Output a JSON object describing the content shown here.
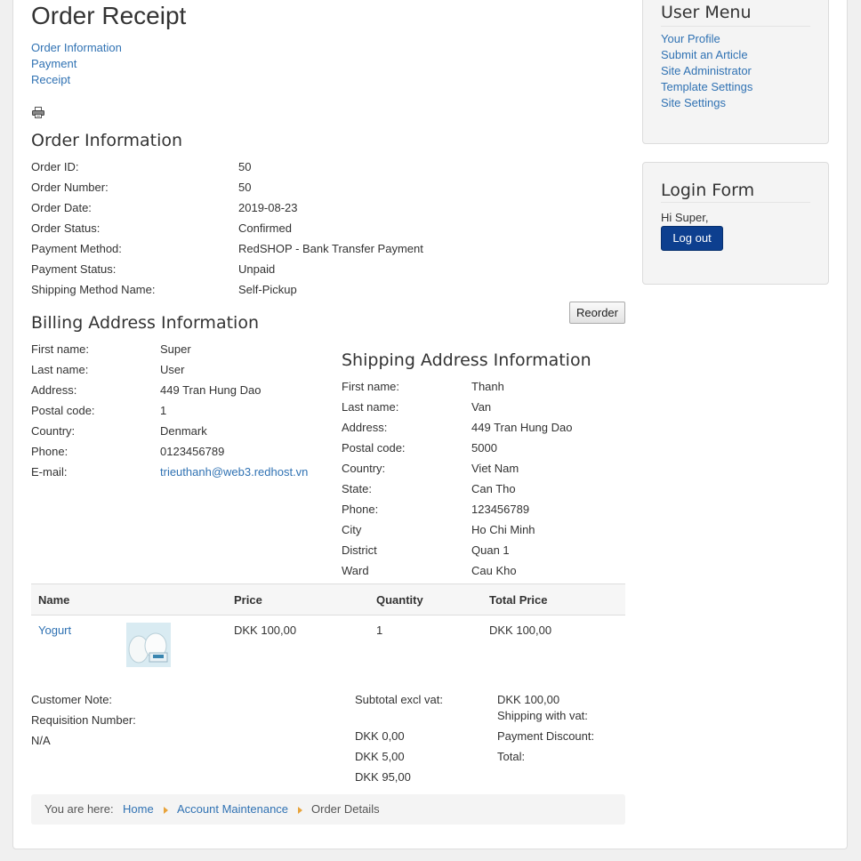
{
  "page": {
    "title": "Order Receipt"
  },
  "steps": [
    "Order Information",
    "Payment",
    "Receipt"
  ],
  "order_info": {
    "heading": "Order Information",
    "rows": [
      {
        "label": "Order ID:",
        "value": "50"
      },
      {
        "label": "Order Number:",
        "value": "50"
      },
      {
        "label": "Order Date:",
        "value": "2019-08-23"
      },
      {
        "label": "Order Status:",
        "value": "Confirmed"
      },
      {
        "label": "Payment Method:",
        "value": "RedSHOP - Bank Transfer Payment"
      },
      {
        "label": "Payment Status:",
        "value": "Unpaid"
      },
      {
        "label": "Shipping Method Name:",
        "value": "Self-Pickup"
      }
    ]
  },
  "reorder_label": "Reorder",
  "billing": {
    "heading": "Billing Address Information",
    "rows": [
      {
        "label": "First name:",
        "value": "Super"
      },
      {
        "label": "Last name:",
        "value": "User"
      },
      {
        "label": "Address:",
        "value": "449 Tran Hung Dao"
      },
      {
        "label": "Postal code:",
        "value": "1"
      },
      {
        "label": "Country:",
        "value": "Denmark"
      },
      {
        "label": "Phone:",
        "value": "0123456789"
      },
      {
        "label": "E-mail:",
        "value": "trieuthanh@web3.redhost.vn"
      }
    ]
  },
  "shipping": {
    "heading": "Shipping Address Information",
    "rows": [
      {
        "label": "First name:",
        "value": "Thanh"
      },
      {
        "label": "Last name:",
        "value": "Van"
      },
      {
        "label": "Address:",
        "value": "449 Tran Hung Dao"
      },
      {
        "label": "Postal code:",
        "value": "5000"
      },
      {
        "label": "Country:",
        "value": "Viet Nam"
      },
      {
        "label": "State:",
        "value": "Can Tho"
      },
      {
        "label": "Phone:",
        "value": "123456789"
      },
      {
        "label": "City",
        "value": "Ho Chi Minh"
      },
      {
        "label": "District",
        "value": "Quan 1"
      },
      {
        "label": "Ward",
        "value": "Cau Kho"
      }
    ]
  },
  "table": {
    "headers": {
      "name": "Name",
      "price": "Price",
      "quantity": "Quantity",
      "total": "Total Price"
    },
    "items": [
      {
        "name": "Yogurt",
        "price": "DKK 100,00",
        "quantity": "1",
        "total": "DKK 100,00"
      }
    ]
  },
  "notes": {
    "customer_note": "Customer Note:",
    "requisition": "Requisition Number:",
    "requisition_value": "N/A"
  },
  "totals": {
    "subtotal_label": "Subtotal excl vat:",
    "subtotal_value": "DKK 100,00",
    "shipping_label": "Shipping with vat:",
    "discount_label": "Payment Discount:",
    "total_label": "Total:",
    "value_1": "DKK 0,00",
    "value_2": "DKK 5,00",
    "value_3": "DKK 95,00"
  },
  "breadcrumb": {
    "prefix": "You are here:",
    "items": [
      "Home",
      "Account Maintenance",
      "Order Details"
    ]
  },
  "user_menu": {
    "title": "User Menu",
    "items": [
      "Your Profile",
      "Submit an Article",
      "Site Administrator",
      "Template Settings",
      "Site Settings"
    ]
  },
  "login": {
    "title": "Login Form",
    "greeting": "Hi Super,",
    "logout_label": "Log out"
  },
  "icons": {
    "print": "printer-icon",
    "breadcrumb_sep": "caret-right-icon"
  },
  "colors": {
    "link": "#3072b3",
    "primary_button": "#0d3f8f",
    "breadcrumb_caret": "#e8a33a"
  }
}
